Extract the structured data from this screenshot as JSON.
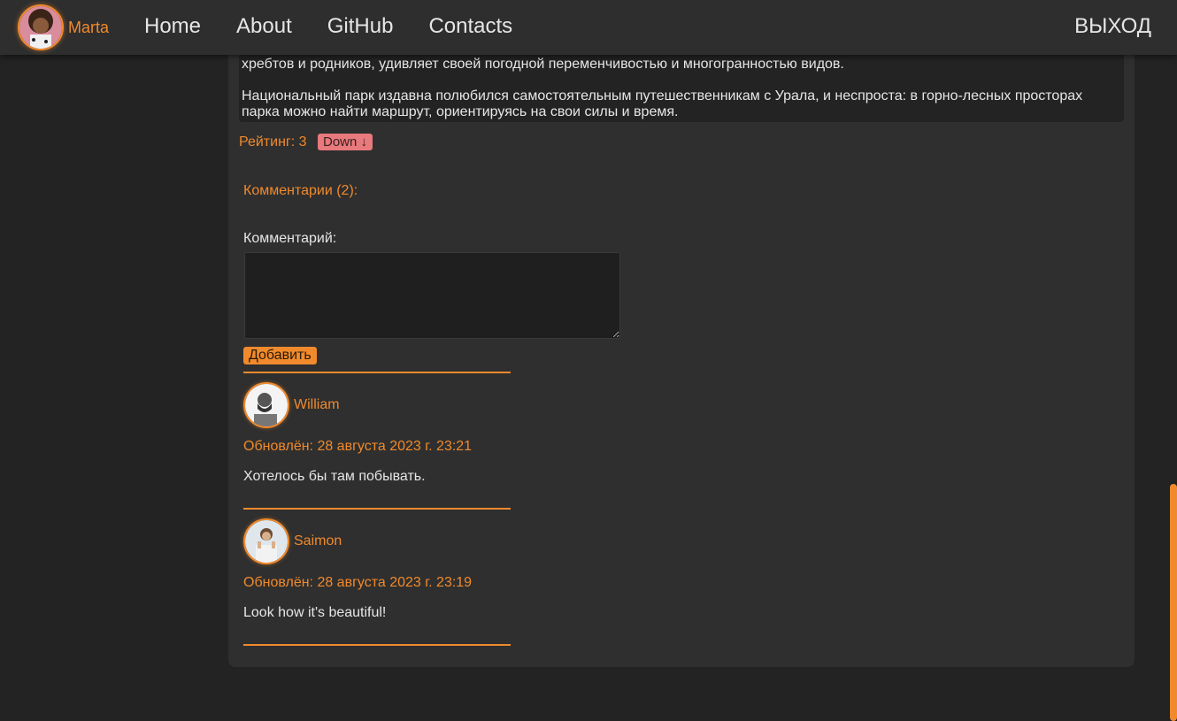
{
  "nav": {
    "user_name": "Marta",
    "links": [
      "Home",
      "About",
      "GitHub",
      "Contacts"
    ],
    "logout": "ВЫХОД"
  },
  "post": {
    "paragraph1_tail": "хребтов и родников, удивляет своей погодной переменчивостью и многогранностью видов.",
    "paragraph2": "Национальный парк издавна полюбился самостоятельным путешественникам с Урала, и неспроста: в горно-лесных просторах парка можно найти маршрут, ориентируясь на свои силы и время.",
    "rating_text": "Рейтинг: 3",
    "down_label": "Down ↓"
  },
  "comments": {
    "title": "Комментарии (2):",
    "form_label": "Комментарий:",
    "add_label": "Добавить",
    "items": [
      {
        "author": "William",
        "date": "Обновлён: 28 августа 2023 г. 23:21",
        "text": "Хотелось бы там побывать."
      },
      {
        "author": "Saimon",
        "date": "Обновлён: 28 августа 2023 г. 23:19",
        "text": "Look how it's beautiful!"
      }
    ]
  },
  "colors": {
    "accent": "#f08a2c",
    "background": "#232323",
    "card": "#2f2f2f",
    "down_button": "#e8797c"
  }
}
